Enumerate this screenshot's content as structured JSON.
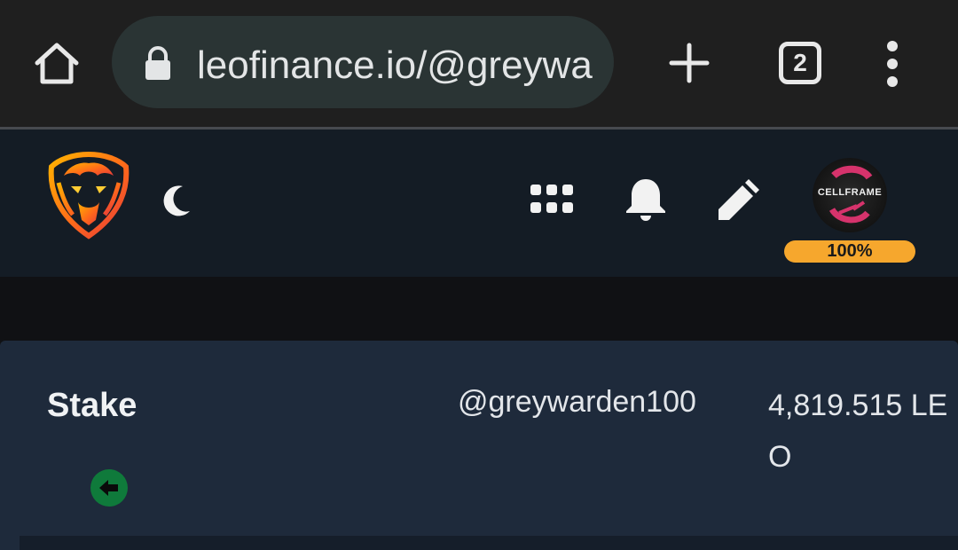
{
  "browser": {
    "url": "leofinance.io/@greywa",
    "tab_count": "2"
  },
  "header": {
    "avatar_label": "CELLFRAME",
    "power_badge": "100%"
  },
  "stake_card": {
    "title": "Stake",
    "username": "@greywarden100",
    "amount": "4,819.515 LEO"
  },
  "colors": {
    "accent_badge": "#f6a72d",
    "back_button": "#0f7a3b",
    "card_background": "#1e2a3b",
    "header_background": "#141c25"
  },
  "icons": [
    "home-icon",
    "lock-icon",
    "plus-icon",
    "tabs-icon",
    "more-vert-icon",
    "leo-lion-logo",
    "moon-icon",
    "apps-grid-icon",
    "bell-icon",
    "pencil-icon",
    "arrow-left-icon"
  ]
}
